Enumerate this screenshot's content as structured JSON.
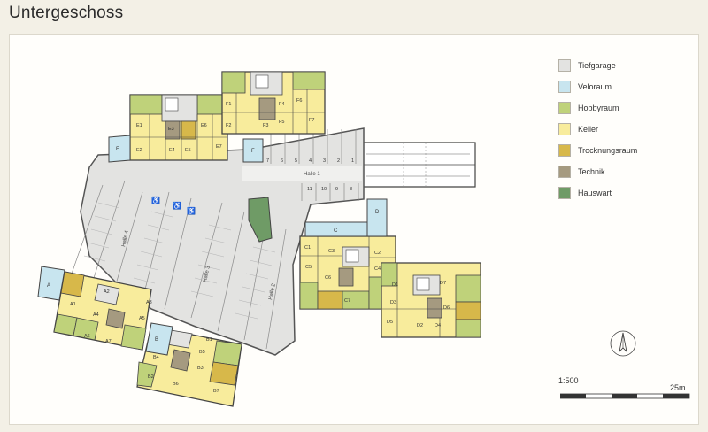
{
  "title": "Untergeschoss",
  "legend": [
    {
      "label": "Tiefgarage",
      "color": "#e3e3e1"
    },
    {
      "label": "Veloraum",
      "color": "#c8e5ef"
    },
    {
      "label": "Hobbyraum",
      "color": "#bfd27a"
    },
    {
      "label": "Keller",
      "color": "#f8ec9c"
    },
    {
      "label": "Trocknungsraum",
      "color": "#d7b84a"
    },
    {
      "label": "Technik",
      "color": "#a59a80"
    },
    {
      "label": "Hauswart",
      "color": "#6f9b66"
    }
  ],
  "scale": {
    "ratio": "1:500",
    "length_label": "25m"
  },
  "hall_labels": [
    "Halle 1",
    "Halle 2",
    "Halle 3",
    "Halle 4"
  ],
  "room_labels": {
    "veloraum": [
      "E",
      "F",
      "C",
      "D",
      "A",
      "B"
    ],
    "house_E": [
      "E1",
      "E2",
      "E3",
      "E4",
      "E5",
      "E6",
      "E7"
    ],
    "house_F": [
      "F1",
      "F2",
      "F3",
      "F4",
      "F5",
      "F6",
      "F7"
    ],
    "house_C": [
      "C1",
      "C2",
      "C3",
      "C4",
      "C5",
      "C6",
      "C7"
    ],
    "house_D": [
      "D1",
      "D2",
      "D3",
      "D4",
      "D5",
      "D6",
      "D7"
    ],
    "house_A": [
      "A1",
      "A2",
      "A3",
      "A4",
      "A5",
      "A6",
      "A7"
    ],
    "house_B": [
      "B1",
      "B2",
      "B3",
      "B4",
      "B5",
      "B6",
      "B7"
    ]
  },
  "parking_numbers": {
    "halle1_top": [
      "7",
      "6",
      "5",
      "4",
      "3",
      "2",
      "1"
    ],
    "halle1_bottom": [
      "11",
      "10",
      "9",
      "8"
    ]
  },
  "icons": {
    "accessible": "wheelchair-icon",
    "north": "north-arrow-icon"
  }
}
